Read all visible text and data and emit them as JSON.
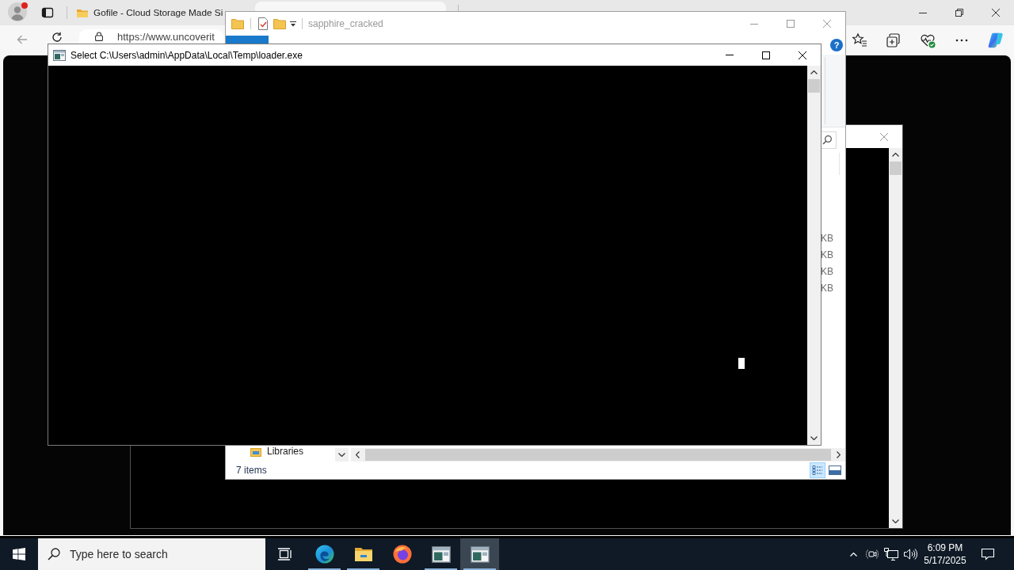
{
  "browser": {
    "tabs": [
      {
        "title": "Gofile - Cloud Storage Made Si",
        "selected": false
      },
      {
        "selected": true
      }
    ],
    "address": "https://www.uncoverit"
  },
  "background_console": {
    "active": false
  },
  "explorer": {
    "title": "sapphire_cracked",
    "active": false,
    "help": "?",
    "size_cells": [
      "KB",
      "KB",
      "KB",
      "KB"
    ],
    "nav_items": [
      {
        "label": "Libraries"
      }
    ],
    "status": "7 items",
    "views": [
      {
        "kind": "details",
        "selected": true
      },
      {
        "kind": "large_icons",
        "selected": false
      }
    ]
  },
  "console": {
    "title": "Select C:\\Users\\admin\\AppData\\Local\\Temp\\loader.exe",
    "active": true,
    "cursor_visible": true
  },
  "taskbar": {
    "search": {
      "placeholder": "Type here to search"
    },
    "apps": [
      {
        "kind": "edge",
        "running": true,
        "selected": false
      },
      {
        "kind": "explorer",
        "running": true,
        "selected": false
      },
      {
        "kind": "firefox",
        "running": false,
        "selected": false
      },
      {
        "kind": "console",
        "running": true,
        "selected": false
      },
      {
        "kind": "console",
        "running": true,
        "selected": true
      }
    ],
    "clock": {
      "time": "6:09 PM",
      "date": "5/17/2025"
    }
  }
}
